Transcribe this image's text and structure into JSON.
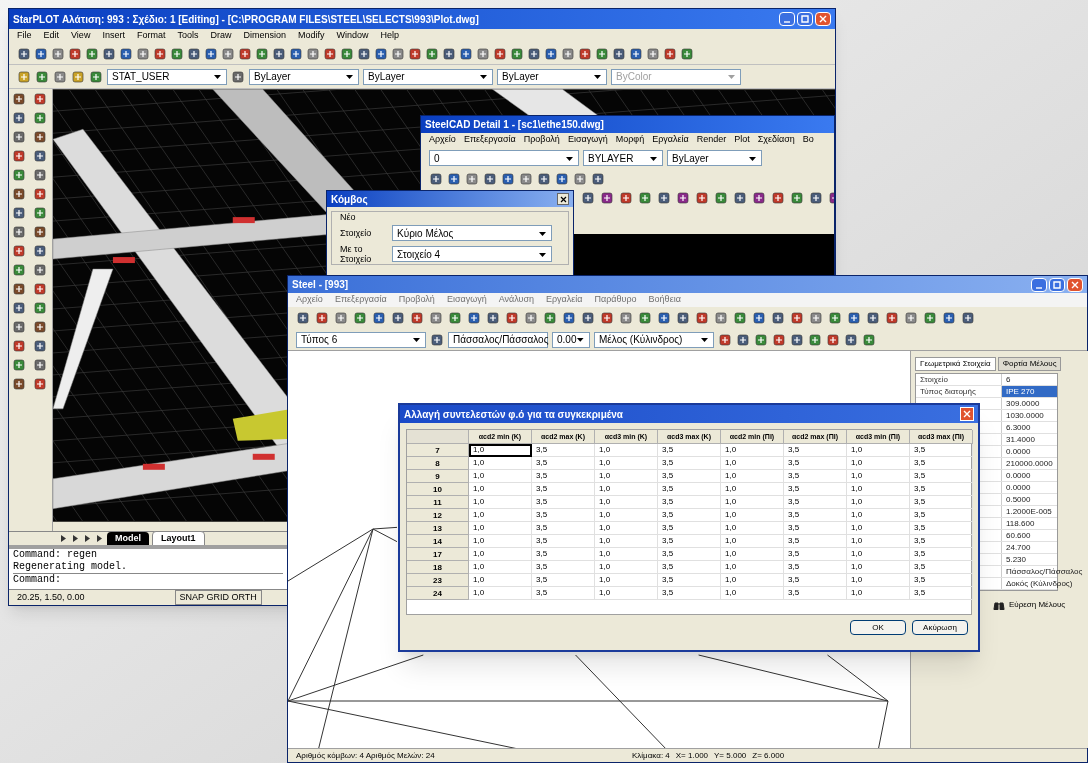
{
  "cad_window": {
    "title": "StarPLOT   Αλάτιση: 993 : Σχέδιο: 1 [Editing] - [C:\\PROGRAM FILES\\STEEL\\SELECTS\\993\\Plot.dwg]",
    "menu": [
      "File",
      "Edit",
      "View",
      "Insert",
      "Format",
      "Tools",
      "Draw",
      "Dimension",
      "Modify",
      "Window",
      "Help"
    ],
    "layer_dropdown": "STAT_USER",
    "dropdowns": [
      "ByLayer",
      "ByLayer",
      "ByLayer"
    ],
    "color_dropdown": {
      "value": "ByColor",
      "disabled": true
    },
    "layout_tabs": [
      {
        "label": "Model",
        "selected": true
      },
      {
        "label": "Layout1",
        "selected": false
      }
    ],
    "command_lines": [
      "Command:  regen",
      "Regenerating model."
    ],
    "command_prompt": "Command:",
    "status": {
      "coordinates": "20.25, 1.50, 0.00",
      "modes": "SNAP GRID ORTH"
    }
  },
  "detail_window": {
    "title": "SteelCAD Detail 1 - [sc1\\ethe150.dwg]",
    "menu": [
      "Αρχείο",
      "Επεξεργασία",
      "Προβολή",
      "Εισαγωγή",
      "Μορφή",
      "Εργαλεία",
      "Render",
      "Plot",
      "Σχεδίαση",
      "Βο"
    ],
    "dropdowns": [
      "0",
      "BYLAYER",
      "ByLayer"
    ]
  },
  "node_dialog": {
    "title": "Κόμβος",
    "group": "Νέο",
    "fields": [
      {
        "label": "Στοιχείο",
        "value": "Κύριο Μέλος"
      },
      {
        "label": "Με το Στοιχείο",
        "value": "Στοιχείο 4"
      }
    ]
  },
  "steel_window": {
    "title": "Steel - [993]",
    "menu": [
      "Αρχείο",
      "Επεξεργασία",
      "Προβολή",
      "Εισαγωγή",
      "Ανάλυση",
      "Εργαλεία",
      "Παράθυρο",
      "Βοήθεια"
    ],
    "dropdowns": [
      "Τύπος 6",
      "Πάσσαλος/Πάσσαλος",
      "0.00",
      "Μέλος (Κύλινδρος)"
    ],
    "panel_tabs": [
      {
        "label": "Γεωμετρικά Στοιχεία",
        "selected": true
      },
      {
        "label": "Φορτία Μέλους",
        "selected": false
      }
    ],
    "properties": [
      {
        "label": "Στοιχείο",
        "value": "6",
        "selected": false
      },
      {
        "label": "Τύπος διατομής",
        "value": "IPE 270",
        "selected": true
      },
      {
        "value": "309.0000",
        "selected": false
      },
      {
        "value": "1030.0000",
        "selected": false
      },
      {
        "value": "6.3000",
        "selected": false
      },
      {
        "value": "31.4000",
        "selected": false
      },
      {
        "value": "0.0000",
        "selected": false
      },
      {
        "value": "210000.0000",
        "selected": false
      },
      {
        "value": "0.0000",
        "selected": false
      },
      {
        "value": "0.0000",
        "selected": false
      },
      {
        "value": "0.5000",
        "selected": false
      },
      {
        "value": "1.2000E-005",
        "selected": false
      },
      {
        "value": "118.600",
        "selected": false
      },
      {
        "value": "60.600",
        "selected": false
      },
      {
        "value": "24.700",
        "selected": false
      },
      {
        "value": "5.230",
        "selected": false
      },
      {
        "value": "Πάσσαλος/Πάσσαλος",
        "selected": false
      },
      {
        "value": "Δοκός (Κύλινδρος)",
        "selected": false
      }
    ],
    "find_button": "Εύρεση Μέλους",
    "status": {
      "counts": "Αριθμός κόμβων: 4  Αριθμός Μελών: 24",
      "scale": "Κλίμακα: 4",
      "x": "X= 1.000",
      "y": "Y= 5.000",
      "z": "Z= 6.000"
    }
  },
  "coef_dialog": {
    "title": "Αλλαγή συντελεστών φ.ό για τα συγκεκριμένα",
    "columns": [
      "αcd2 min (K)",
      "αcd2 max (K)",
      "αcd3 min (K)",
      "αcd3 max (K)",
      "αcd2 min (ΠΙ)",
      "αcd2 max (ΠΙ)",
      "αcd3 min (ΠΙ)",
      "αcd3 max (ΠΙ)"
    ],
    "rows": [
      {
        "label": "7",
        "selected": true,
        "cells": [
          "1,0",
          "3,5",
          "1,0",
          "3,5",
          "1,0",
          "3,5",
          "1,0",
          "3,5"
        ]
      },
      {
        "label": "8",
        "selected": false,
        "cells": [
          "1,0",
          "3,5",
          "1,0",
          "3,5",
          "1,0",
          "3,5",
          "1,0",
          "3,5"
        ]
      },
      {
        "label": "9",
        "selected": false,
        "cells": [
          "1,0",
          "3,5",
          "1,0",
          "3,5",
          "1,0",
          "3,5",
          "1,0",
          "3,5"
        ]
      },
      {
        "label": "10",
        "selected": false,
        "cells": [
          "1,0",
          "3,5",
          "1,0",
          "3,5",
          "1,0",
          "3,5",
          "1,0",
          "3,5"
        ]
      },
      {
        "label": "11",
        "selected": false,
        "cells": [
          "1,0",
          "3,5",
          "1,0",
          "3,5",
          "1,0",
          "3,5",
          "1,0",
          "3,5"
        ]
      },
      {
        "label": "12",
        "selected": false,
        "cells": [
          "1,0",
          "3,5",
          "1,0",
          "3,5",
          "1,0",
          "3,5",
          "1,0",
          "3,5"
        ]
      },
      {
        "label": "13",
        "selected": false,
        "cells": [
          "1,0",
          "3,5",
          "1,0",
          "3,5",
          "1,0",
          "3,5",
          "1,0",
          "3,5"
        ]
      },
      {
        "label": "14",
        "selected": false,
        "cells": [
          "1,0",
          "3,5",
          "1,0",
          "3,5",
          "1,0",
          "3,5",
          "1,0",
          "3,5"
        ]
      },
      {
        "label": "17",
        "selected": false,
        "cells": [
          "1,0",
          "3,5",
          "1,0",
          "3,5",
          "1,0",
          "3,5",
          "1,0",
          "3,5"
        ]
      },
      {
        "label": "18",
        "selected": false,
        "cells": [
          "1,0",
          "3,5",
          "1,0",
          "3,5",
          "1,0",
          "3,5",
          "1,0",
          "3,5"
        ]
      },
      {
        "label": "23",
        "selected": false,
        "cells": [
          "1,0",
          "3,5",
          "1,0",
          "3,5",
          "1,0",
          "3,5",
          "1,0",
          "3,5"
        ]
      },
      {
        "label": "24",
        "selected": false,
        "cells": [
          "1,0",
          "3,5",
          "1,0",
          "3,5",
          "1,0",
          "3,5",
          "1,0",
          "3,5"
        ]
      }
    ],
    "buttons": [
      "OK",
      "Ακύρωση"
    ]
  }
}
